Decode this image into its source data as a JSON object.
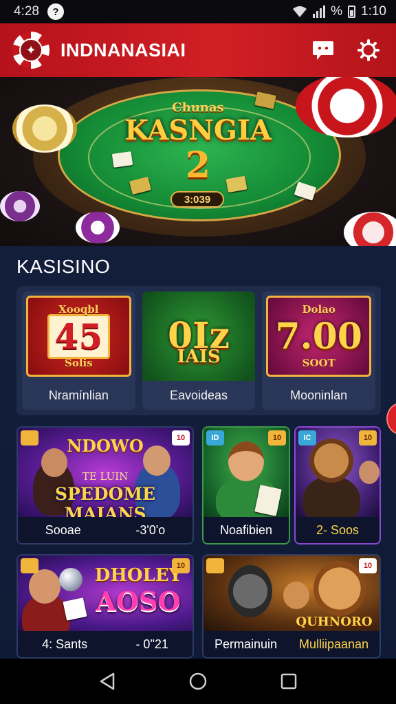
{
  "status_bar": {
    "time_left": "4:28",
    "time_right": "1:10",
    "percent": "%"
  },
  "app_bar": {
    "title": "INDNANASIAI"
  },
  "hero": {
    "subtitle": "Chunas",
    "title": "KASNGIA",
    "number": "2",
    "pill": "3:039"
  },
  "section": {
    "title": "KASISINO"
  },
  "top_tiles": [
    {
      "top": "Xooqbl",
      "big": "45",
      "bottom": "Solis",
      "label": "Nramínlian"
    },
    {
      "top": "",
      "big": "0Iz",
      "bottom": "IAIS",
      "label": "Eavoideas"
    },
    {
      "top": "Dolao",
      "big": "7.00",
      "bottom": "SOOT",
      "label": "Mooninlan"
    }
  ],
  "games": [
    {
      "title": "NDOWO",
      "subtitle": "TE LUIN",
      "banner": "SPEDOME MAIANS",
      "left": "Sooae",
      "right": "-3'0'o",
      "badge": "10"
    },
    {
      "label": "Noafibien",
      "badge_left": "ID",
      "badge_right": "10"
    },
    {
      "label": "2- Soos",
      "badge_left": "IC",
      "badge_right": "10"
    },
    {
      "title": "DHOLEY",
      "banner": "AOSO",
      "left": "4: Sants",
      "right": "- 0\"21",
      "badge": "10"
    },
    {
      "banner": "QUHNORO",
      "left": "Permainuin",
      "right": "Mulliipaanan",
      "badge": "10"
    }
  ],
  "colors": {
    "accent": "#d11f25",
    "background": "#101a33",
    "gold": "#ffcf3f"
  },
  "icons": [
    "shield-logo-icon",
    "chat-icon",
    "settings-icon",
    "back-icon",
    "home-icon",
    "recents-icon"
  ]
}
